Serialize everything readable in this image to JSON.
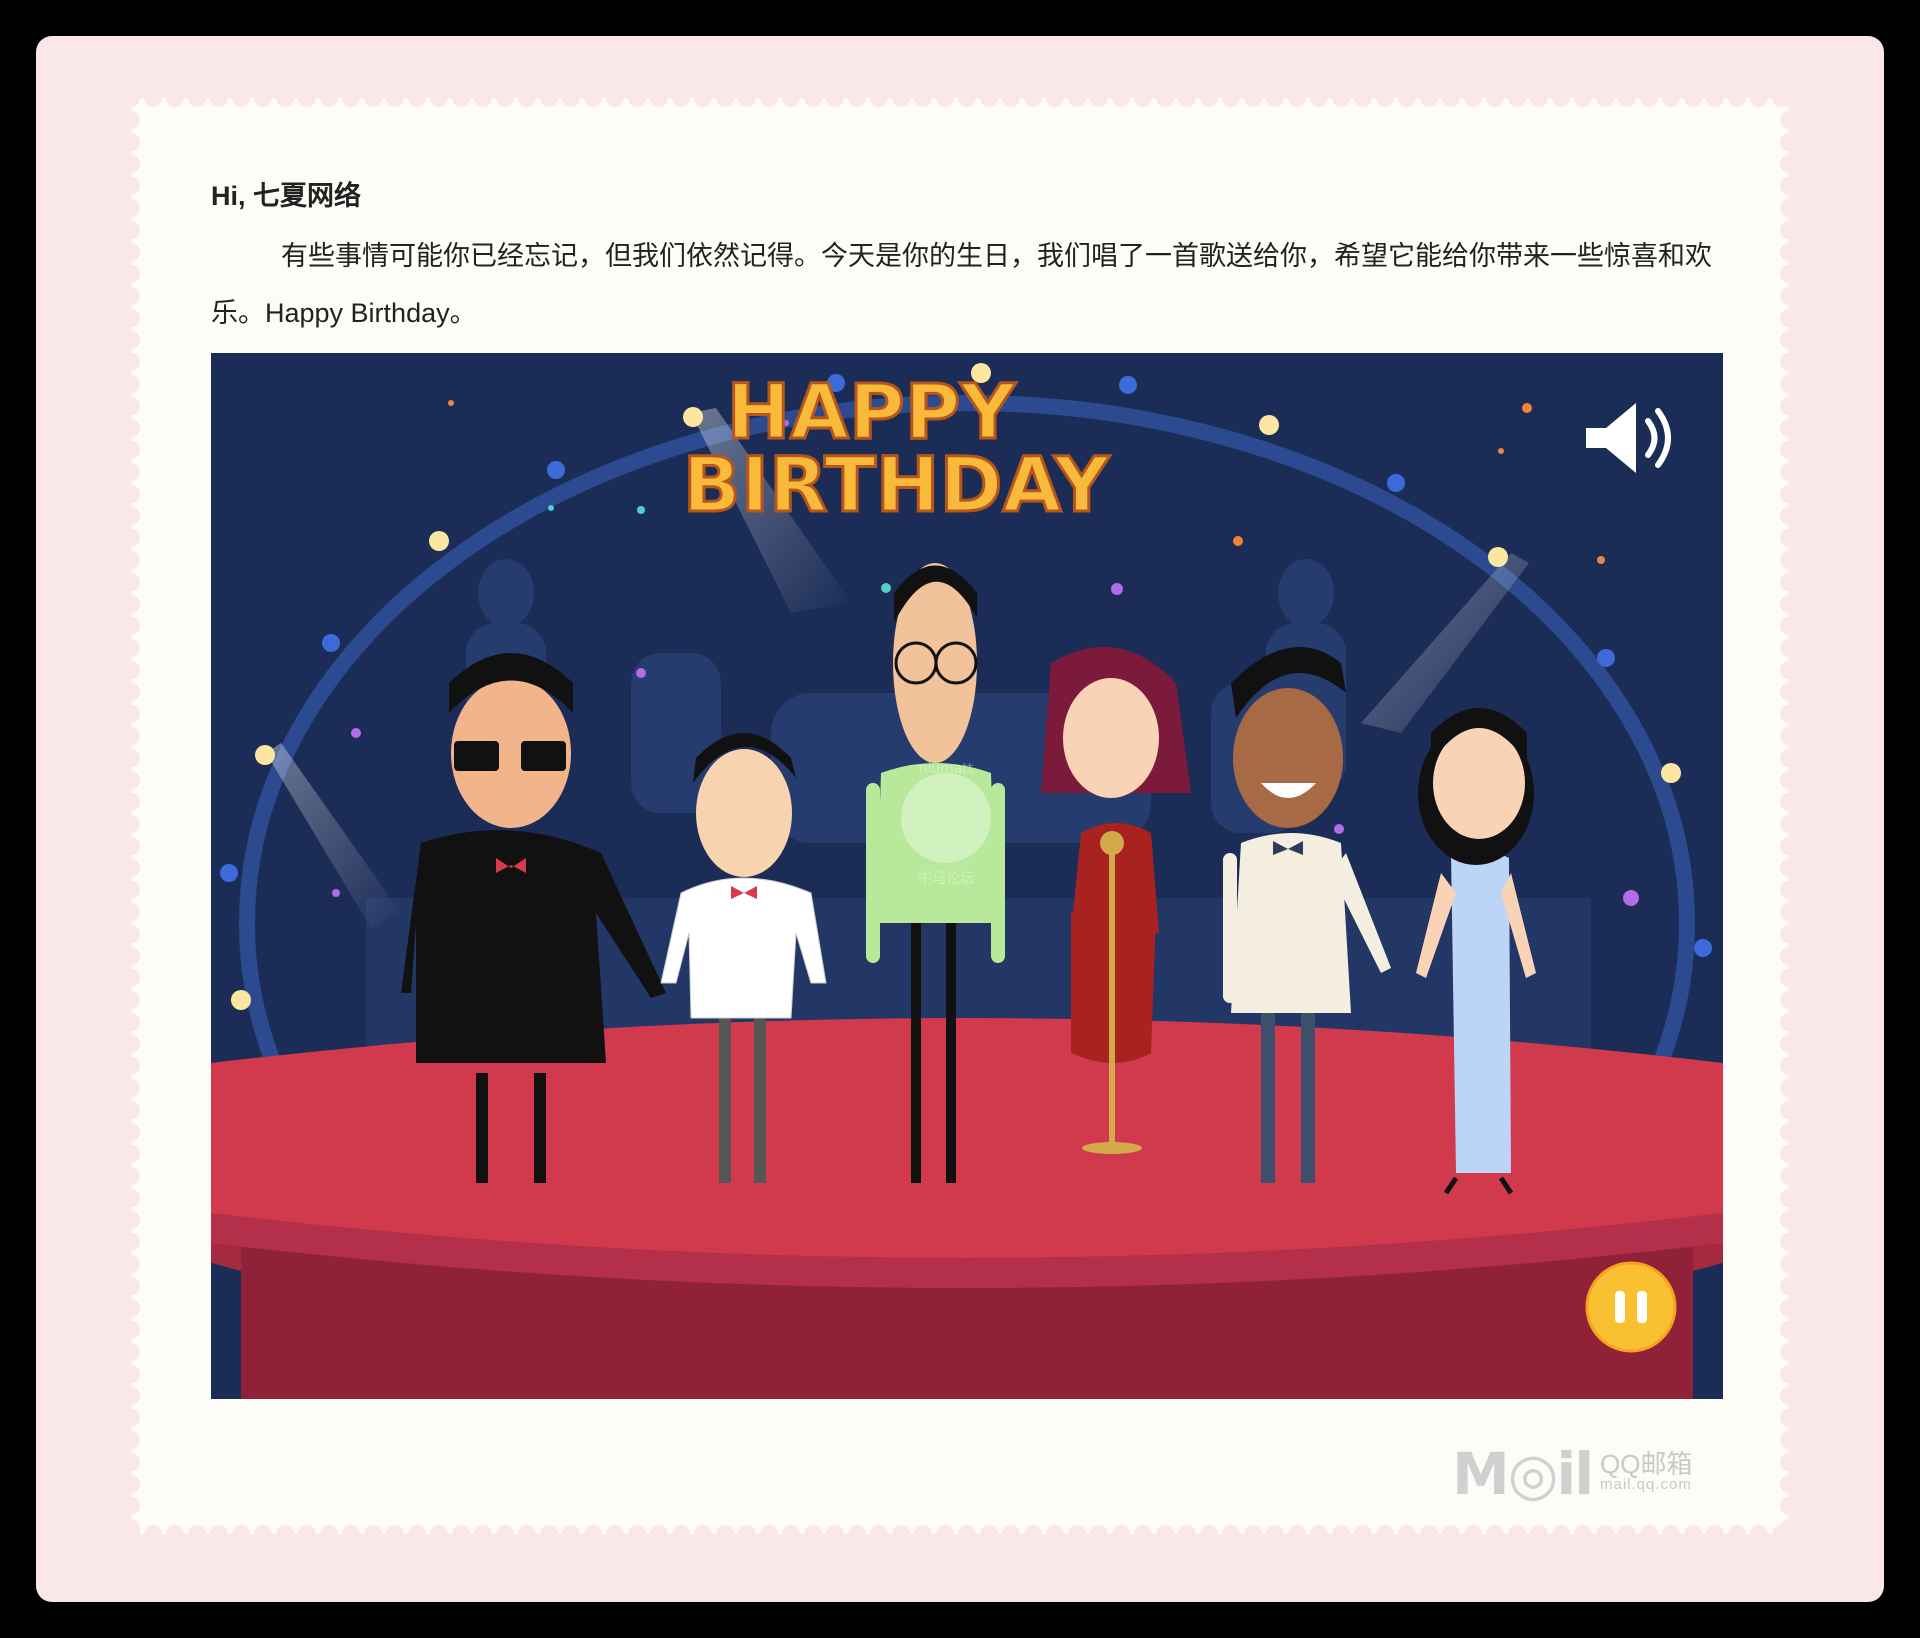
{
  "email": {
    "greeting": "Hi, 七夏网络",
    "message": "有些事情可能你已经忘记，但我们依然记得。今天是你的生日，我们唱了一首歌送给你，希望它能给你带来一些惊喜和欢乐。Happy Birthday。"
  },
  "video": {
    "title_line1": "HAPPY",
    "title_line2": "BIRTHDAY",
    "watermark_top": "niumatt",
    "watermark_bottom": "牛马论坛",
    "sound_icon": "speaker-volume-icon",
    "pause_icon": "pause-icon"
  },
  "footer": {
    "logo_brand": "M◎il",
    "logo_name": "QQ邮箱",
    "logo_domain": "mail.qq.com"
  },
  "colors": {
    "page_bg": "#fae8e9",
    "card_bg": "#fdfcf7",
    "stage_bg": "#1b2d57",
    "stage_red": "#d13a4c",
    "title_gold": "#f9b93b",
    "pause_yellow": "#f9c132"
  }
}
